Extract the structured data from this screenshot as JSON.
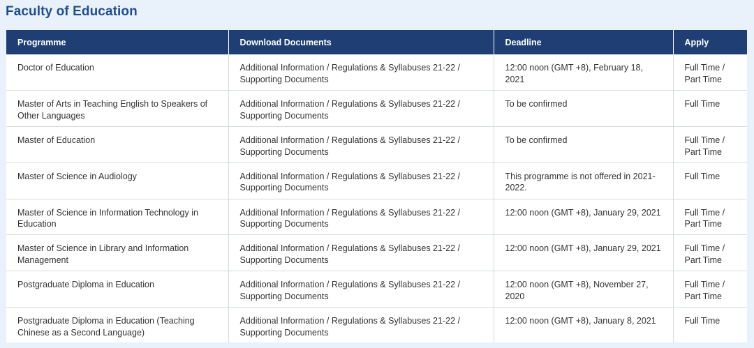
{
  "page": {
    "title": "Faculty of Education"
  },
  "table": {
    "headers": {
      "programme": "Programme",
      "documents": "Download Documents",
      "deadline": "Deadline",
      "apply": "Apply"
    },
    "rows": [
      {
        "programme": "Doctor of Education",
        "documents": "Additional Information / Regulations & Syllabuses 21-22 / Supporting Documents",
        "deadline": "12:00 noon (GMT +8), February 18, 2021",
        "apply": "Full Time / Part Time"
      },
      {
        "programme": "Master of Arts in Teaching English to Speakers of Other Languages",
        "documents": "Additional Information / Regulations & Syllabuses 21-22 / Supporting Documents",
        "deadline": "To be confirmed",
        "apply": "Full Time"
      },
      {
        "programme": "Master of Education",
        "documents": "Additional Information / Regulations & Syllabuses 21-22 / Supporting Documents",
        "deadline": "To be confirmed",
        "apply": "Full Time / Part Time"
      },
      {
        "programme": "Master of Science in Audiology",
        "documents": "Additional Information / Regulations & Syllabuses 21-22 / Supporting Documents",
        "deadline": "This programme is not offered in 2021-2022.",
        "apply": "Full Time"
      },
      {
        "programme": "Master of Science in Information Technology in Education",
        "documents": "Additional Information / Regulations & Syllabuses 21-22 / Supporting Documents",
        "deadline": "12:00 noon (GMT +8), January 29, 2021",
        "apply": "Full Time / Part Time"
      },
      {
        "programme": "Master of Science in Library and Information Management",
        "documents": "Additional Information / Regulations & Syllabuses 21-22 / Supporting Documents",
        "deadline": "12:00 noon (GMT +8), January 29, 2021",
        "apply": "Full Time / Part Time"
      },
      {
        "programme": "Postgraduate Diploma in Education",
        "documents": "Additional Information / Regulations & Syllabuses 21-22 / Supporting Documents",
        "deadline": "12:00 noon (GMT +8), November 27, 2020",
        "apply": "Full Time / Part Time"
      },
      {
        "programme": "Postgraduate Diploma in Education (Teaching Chinese as a Second Language)",
        "documents": "Additional Information / Regulations & Syllabuses 21-22 / Supporting Documents",
        "deadline": "12:00 noon (GMT +8), January 8, 2021",
        "apply": "Full Time"
      }
    ]
  },
  "colors": {
    "header_bg": "#1f3f74",
    "page_bg": "#e9f2fb",
    "title_color": "#1f4e8c"
  }
}
